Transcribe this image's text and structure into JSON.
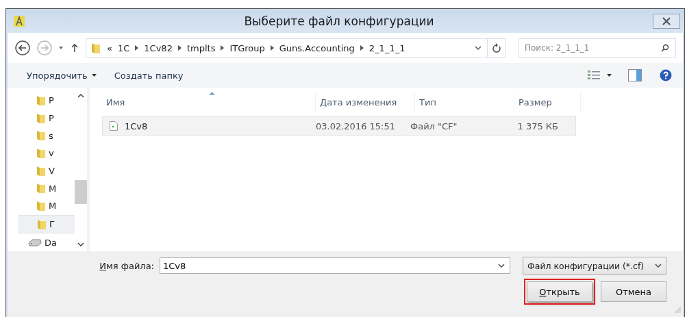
{
  "window": {
    "title": "Выберите файл конфигурации"
  },
  "address": {
    "overflow": "«",
    "crumbs": [
      "1C",
      "1Cv82",
      "tmplts",
      "ITGroup",
      "Guns.Accounting",
      "2_1_1_1"
    ]
  },
  "search": {
    "placeholder": "Поиск: 2_1_1_1"
  },
  "toolbar": [
    {
      "label": "Упорядочить",
      "kind": "menu"
    },
    {
      "label": "Создать папку",
      "kind": "plain"
    }
  ],
  "nav_items": [
    {
      "label": "P",
      "kind": "folder",
      "selected": false
    },
    {
      "label": "P",
      "kind": "folder",
      "selected": false
    },
    {
      "label": "s",
      "kind": "folder",
      "selected": false
    },
    {
      "label": "v",
      "kind": "folder",
      "selected": false
    },
    {
      "label": "V",
      "kind": "folder",
      "selected": false
    },
    {
      "label": "M",
      "kind": "folder",
      "selected": false
    },
    {
      "label": "M",
      "kind": "folder",
      "selected": false
    },
    {
      "label": "Г",
      "kind": "folder",
      "selected": true
    },
    {
      "label": "Da",
      "kind": "drive",
      "selected": false
    }
  ],
  "table": {
    "columns": [
      {
        "label": "Имя",
        "sorted": true
      },
      {
        "label": "Дата изменения",
        "sorted": false
      },
      {
        "label": "Тип",
        "sorted": false
      },
      {
        "label": "Размер",
        "sorted": false
      }
    ],
    "rows": [
      {
        "name": "1Cv8",
        "modified": "03.02.2016 15:51",
        "type": "Файл \"CF\"",
        "size": "1 375 КБ",
        "highlighted": true
      }
    ]
  },
  "file_name": {
    "label": "Имя файла:",
    "value": "1Cv8"
  },
  "file_type": {
    "value": "Файл конфигурации (*.cf)"
  },
  "buttons": [
    {
      "label": "Открыть",
      "highlighted": true
    },
    {
      "label": "Отмена",
      "highlighted": false
    }
  ]
}
